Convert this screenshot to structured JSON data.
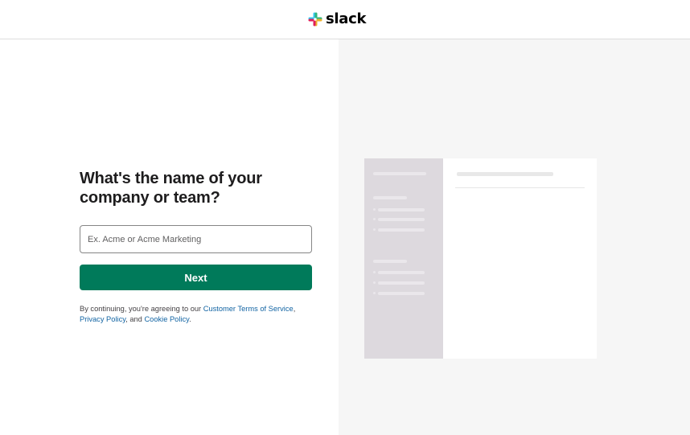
{
  "brand": {
    "name": "slack"
  },
  "form": {
    "heading": "What's the name of your company or team?",
    "input_placeholder": "Ex. Acme or Acme Marketing",
    "input_value": "",
    "next_label": "Next"
  },
  "terms": {
    "prefix": "By continuing, you're agreeing to our ",
    "link_tos": "Customer Terms of Service",
    "sep1": ", ",
    "link_privacy": "Privacy Policy",
    "sep2": ", and ",
    "link_cookie": "Cookie Policy",
    "suffix": "."
  },
  "colors": {
    "primary_button": "#007a5a",
    "link": "#1264a3",
    "preview_sidebar": "#ddd9de",
    "right_panel_bg": "#f6f6f6"
  }
}
